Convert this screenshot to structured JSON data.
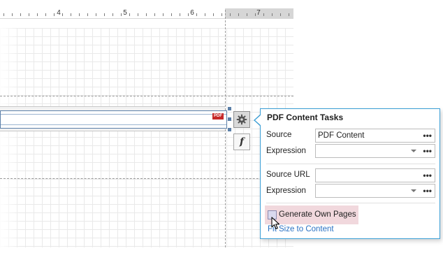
{
  "ruler": {
    "labels": [
      "4",
      "5",
      "6",
      "7"
    ]
  },
  "control": {
    "badge": "PDF"
  },
  "side_buttons": {
    "expression_glyph": "f"
  },
  "panel": {
    "title": "PDF Content Tasks",
    "source_label": "Source",
    "source_value": "PDF Content",
    "expression1_label": "Expression",
    "expression1_value": "",
    "source_url_label": "Source URL",
    "source_url_value": "",
    "expression2_label": "Expression",
    "expression2_value": "",
    "browse_glyph": "•••",
    "generate_own_pages_label": "Generate Own Pages",
    "generate_own_pages_checked": false,
    "fit_size_link": "Fit Size to Content"
  },
  "colors": {
    "accent": "#3a9ed6",
    "selection": "#5b7fa8",
    "pdf_badge": "#c62828",
    "link": "#2a72c4",
    "hover_highlight": "#f1d8dd"
  },
  "icons": [
    "gear-icon",
    "function-icon",
    "pdf-icon",
    "dropdown-arrow-icon",
    "ellipsis-icon",
    "mouse-cursor-icon"
  ]
}
